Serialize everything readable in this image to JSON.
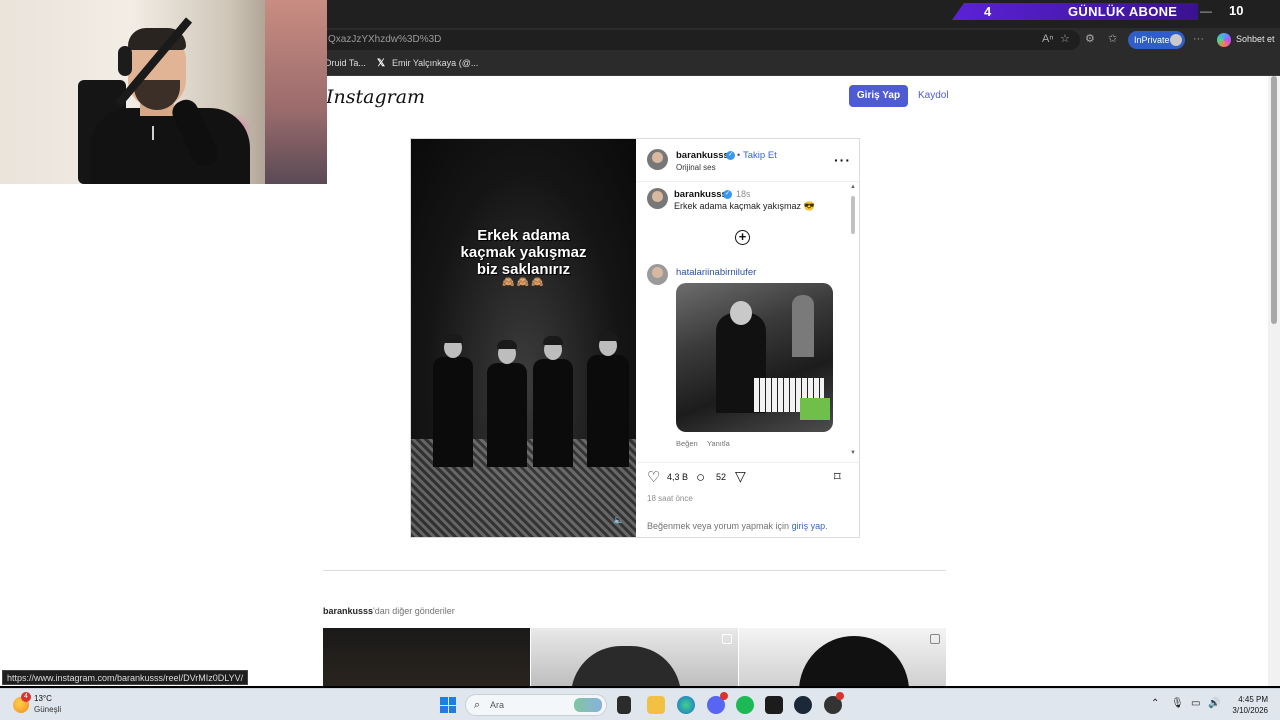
{
  "stream": {
    "count": "4",
    "label": "GÜNLÜK ABONE",
    "corner_num": "10"
  },
  "browser": {
    "url": "QxazJzYXhzdw%3D%3D",
    "inprivate_label": "InPrivate",
    "chat_label": "Sohbet et",
    "bookmarks": [
      "Druid Ta...",
      "Emir Yalçınkaya (@..."
    ]
  },
  "instagram": {
    "logo": "Instagram",
    "login_label": "Giriş Yap",
    "signup_label": "Kaydol",
    "reel_caption": [
      "Erkek adama",
      "kaçmak yakışmaz",
      "biz saklanırız"
    ],
    "reel_emoji": "🙈🙈🙈",
    "post": {
      "username": "barankusss",
      "follow_label": "Takip Et",
      "audio": "Orijinal ses",
      "caption_user": "barankusss",
      "caption_time": "18s",
      "caption": "Erkek adama kaçmak yakışmaz 😎",
      "comment_user": "hatalariinabirnilufer",
      "comment_like": "Beğen",
      "comment_reply": "Yanıtla",
      "likes": "4,3 B",
      "comments": "52",
      "time_ago": "18 saat önce",
      "login_hint_prefix": "Beğenmek veya yorum yapmak için ",
      "login_hint_link": "giriş yap",
      "login_hint_suffix": "."
    },
    "more_posts": {
      "user": "barankusss",
      "suffix": "'dan diğer gönderiler"
    }
  },
  "status_url": "https://www.instagram.com/barankusss/reel/DVrMIz0DLYV/",
  "taskbar": {
    "temperature": "13°C",
    "condition": "Güneşli",
    "weather_badge": "4",
    "search_placeholder": "Ara",
    "time": "4:45 PM",
    "date": "3/10/2026"
  },
  "colors": {
    "ig_blue": "#4f5bd5",
    "link_blue": "#3565c8",
    "banner_purple": "#5b22d6"
  }
}
